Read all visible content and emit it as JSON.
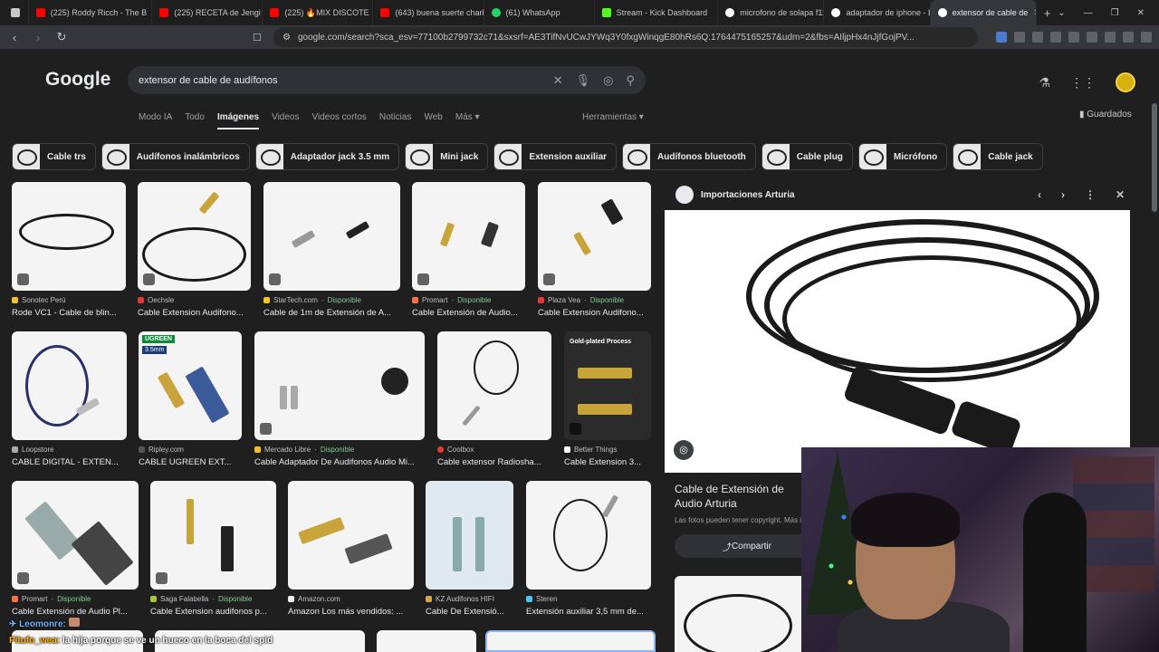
{
  "browser": {
    "tabs": [
      {
        "label": "(225) Roddy Ricch - The B",
        "color": "#ff0000"
      },
      {
        "label": "(225) RECETA de Jengi de",
        "color": "#ff0000"
      },
      {
        "label": "(225) 🔥MIX DISCOTE",
        "color": "#ff0000"
      },
      {
        "label": "(643) buena suerte charlie",
        "color": "#ff0000"
      },
      {
        "label": "(61) WhatsApp",
        "color": "#25d366"
      },
      {
        "label": "Stream - Kick Dashboard",
        "color": "#53fc18"
      },
      {
        "label": "microfono de solapa f11",
        "color": "#ffffff"
      },
      {
        "label": "adaptador de iphone - B",
        "color": "#ffffff"
      },
      {
        "label": "extensor de cable de",
        "color": "#ffffff"
      }
    ],
    "url": "google.com/search?sca_esv=77100b2799732c71&sxsrf=AE3TifNvUCwJYWq3Y0fxgWinqgE80hRs6Q:1764475165257&udm=2&fbs=AIljpHx4nJjfGojPV..."
  },
  "google": {
    "logo": "Google",
    "query": "extensor de cable de audífonos",
    "nav_tabs": [
      "Modo IA",
      "Todo",
      "Imágenes",
      "Videos",
      "Videos cortos",
      "Noticias",
      "Web",
      "Más ▾"
    ],
    "tools": "Herramientas ▾",
    "saved": "Guardados",
    "chips": [
      "Cable trs",
      "Audífonos inalámbricos",
      "Adaptador jack 3.5 mm",
      "Mini jack",
      "Extension auxiliar",
      "Audífonos bluetooth",
      "Cable plug",
      "Micrófono",
      "Cable jack"
    ],
    "results": [
      {
        "source": "Sonotec Perú",
        "title": "Rode VC1 - Cable de blin...",
        "available": ""
      },
      {
        "source": "Oechsle",
        "title": "Cable Extension Audifono...",
        "available": ""
      },
      {
        "source": "StarTech.com",
        "title": "Cable de 1m de Extensión de A...",
        "available": "Disponible"
      },
      {
        "source": "Promart",
        "title": "Cable Extensión de Audio...",
        "available": "Disponible"
      },
      {
        "source": "Plaza Vea",
        "title": "Cable Extension Audifono...",
        "available": "Disponible"
      },
      {
        "source": "Loopstore",
        "title": "CABLE DIGITAL - EXTEN...",
        "available": ""
      },
      {
        "source": "Ripley.com",
        "title": "CABLE UGREEN EXT...",
        "available": ""
      },
      {
        "source": "Mercado Libre",
        "title": "Cable Adaptador De Audifonos Audio Mi...",
        "available": "Disponible"
      },
      {
        "source": "Coolbox",
        "title": "Cable extensor Radiosha...",
        "available": ""
      },
      {
        "source": "Better Things",
        "title": "Cable Extension 3...",
        "available": ""
      },
      {
        "source": "Promart",
        "title": "Cable Extensión de Audio Pl...",
        "available": "Disponible"
      },
      {
        "source": "Saga Falabella",
        "title": "Cable Extension audifonos p...",
        "available": "Disponible"
      },
      {
        "source": "Amazon.com",
        "title": "Amazon Los más vendidos: ...",
        "available": ""
      },
      {
        "source": "KZ Audifonos HIFI",
        "title": "Cable De Extensió...",
        "available": ""
      },
      {
        "source": "Steren",
        "title": "Extensión auxiliar 3,5 mm de...",
        "available": ""
      }
    ],
    "badges": {
      "ugreen": "UGREEN",
      "size": "3.5mm",
      "gold": "Gold-plated Process"
    }
  },
  "panel": {
    "source": "Importaciones Arturia",
    "title": "Cable de Extensión de Audio Arturia",
    "note": "Las fotos pueden tener copyright. Más i",
    "share": "Compartir"
  },
  "chat": {
    "user1": "Leomonre:",
    "user2": "Pitufo_wea:",
    "message2": "la hija porque se ve un hueco en la boca del spid"
  }
}
